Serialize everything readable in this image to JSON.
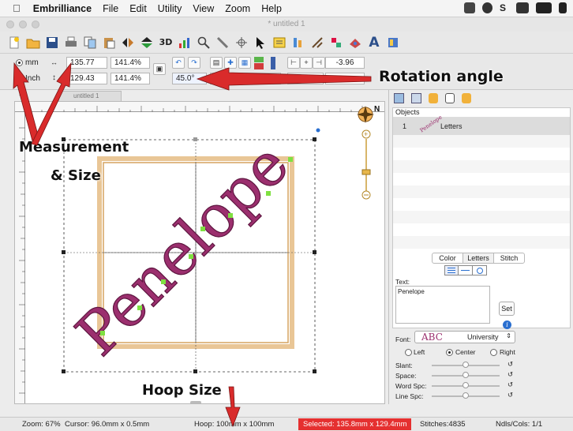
{
  "menubar": {
    "app": "Embrilliance",
    "items": [
      "File",
      "Edit",
      "Utility",
      "View",
      "Zoom",
      "Help"
    ]
  },
  "window": {
    "title": "* untitled 1"
  },
  "toolbar": {
    "icons": [
      "new-icon",
      "open-icon",
      "save-icon",
      "print-icon",
      "copy-icon",
      "paste-icon",
      "flip-horizontal-icon",
      "flip-vertical-icon",
      "3d-view-icon",
      "chart-icon",
      "zoom-icon",
      "needle-icon",
      "hoop-icon",
      "select-arrow-icon",
      "letters-icon",
      "sequence-icon",
      "split-icon",
      "merge-icon",
      "color-icon",
      "text-icon",
      "library-icon"
    ],
    "label_3d": "3D"
  },
  "props": {
    "unit_mm": "mm",
    "unit_inch": "Inch",
    "width": "135.77",
    "width_pct": "141.4%",
    "height": "129.43",
    "height_pct": "141.4%",
    "rotation": "45.0°",
    "offset": "-3.96"
  },
  "callouts": {
    "rotation": "Rotation angle",
    "measurement_line1": "Measurement",
    "measurement_line2": "& Size",
    "hoop": "Hoop Size"
  },
  "tab": {
    "label": "untitled 1"
  },
  "design": {
    "text": "Penelope",
    "thread_color": "#9b2f6e",
    "hoop_color": "#e8b473"
  },
  "compass": "N",
  "objects_panel": {
    "header": "Objects",
    "rows": [
      {
        "index": "1",
        "thumb": "Penelope",
        "name": "Letters"
      }
    ]
  },
  "inspector": {
    "tabs": [
      "Color",
      "Letters",
      "Stitch"
    ],
    "active_tab": "Letters",
    "text_label": "Text:",
    "text_value": "Penelope",
    "set_button": "Set",
    "font_label": "Font:",
    "font_sample": "ABC",
    "font_name": "University",
    "align": [
      "Left",
      "Center",
      "Right"
    ],
    "align_selected": "Center",
    "sliders": [
      {
        "label": "Slant:",
        "value": 0.5
      },
      {
        "label": "Space:",
        "value": 0.5
      },
      {
        "label": "Word Spc:",
        "value": 0.5
      },
      {
        "label": "Line Spc:",
        "value": 0.5
      }
    ]
  },
  "status": {
    "zoom": "Zoom: 67%",
    "cursor": "Cursor: 96.0mm x 0.5mm",
    "hoop": "Hoop: 100mm x 100mm",
    "selected": "Selected: 135.8mm x 129.4mm",
    "stitches": "Stitches:4835",
    "ndls": "Ndls/Cols: 1/1"
  },
  "colors": {
    "accent_red": "#d92b2b",
    "selected_red": "#e53030",
    "info_blue": "#2a6fd0"
  }
}
